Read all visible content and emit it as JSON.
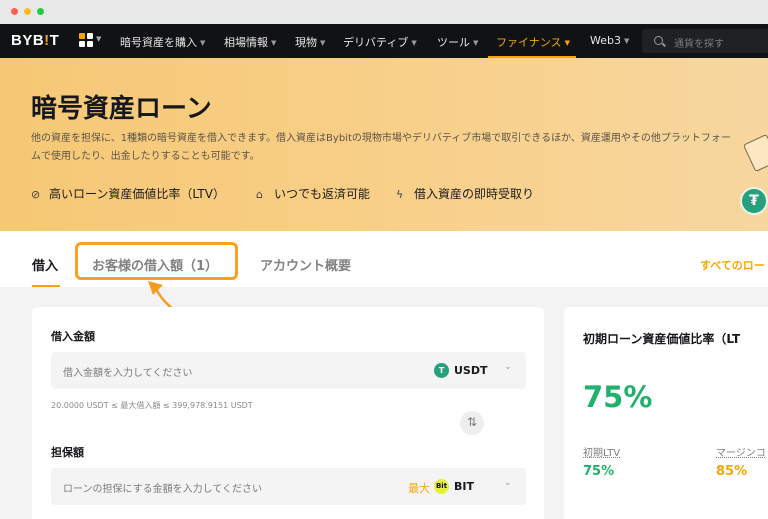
{
  "nav": {
    "logo_main": "BYB",
    "logo_accent": "!",
    "logo_end": "T",
    "items": [
      {
        "label": "暗号資産を購入"
      },
      {
        "label": "相場情報"
      },
      {
        "label": "現物"
      },
      {
        "label": "デリバティブ"
      },
      {
        "label": "ツール"
      },
      {
        "label": "ファイナンス",
        "active": true
      },
      {
        "label": "Web3"
      }
    ],
    "search_placeholder": "通貨を探す"
  },
  "hero": {
    "title": "暗号資産ローン",
    "description": "他の資産を担保に、1種類の暗号資産を借入できます。借入資産はBybitの現物市場やデリバティブ市場で取引できるほか、資産運用やその他プラットフォームで使用したり、出金したりすることも可能です。",
    "features": [
      {
        "icon": "check-circle-icon",
        "text": "高いローン資産価値比率（LTV）"
      },
      {
        "icon": "bank-icon",
        "text": "いつでも返済可能"
      },
      {
        "icon": "lightning-icon",
        "text": "借入資産の即時受取り"
      }
    ]
  },
  "tabs": {
    "borrow": "借入",
    "my_borrowings": "お客様の借入額（1）",
    "account_overview": "アカウント概要",
    "view_all": "すべてのロー"
  },
  "borrow_form": {
    "amount_label": "借入金額",
    "amount_placeholder": "借入金額を入力してください",
    "borrow_coin": "USDT",
    "borrow_coin_icon_text": "T",
    "range_text": "20.0000 USDT ≤ 最大借入額 ≤ 399,978.9151 USDT",
    "collateral_label": "担保額",
    "collateral_placeholder": "ローンの担保にする金額を入力してください",
    "max_label": "最大",
    "collateral_coin": "BIT",
    "collateral_coin_icon_text": "Bit"
  },
  "ltv_panel": {
    "title": "初期ローン資産価値比率（LT",
    "value": "75%",
    "initial_ltv_label": "初期LTV",
    "initial_ltv_value": "75%",
    "margin_label": "マージンコ",
    "margin_value": "85%"
  },
  "colors": {
    "accent": "#f7a600",
    "positive": "#20b26c",
    "nav_bg": "#111214"
  }
}
